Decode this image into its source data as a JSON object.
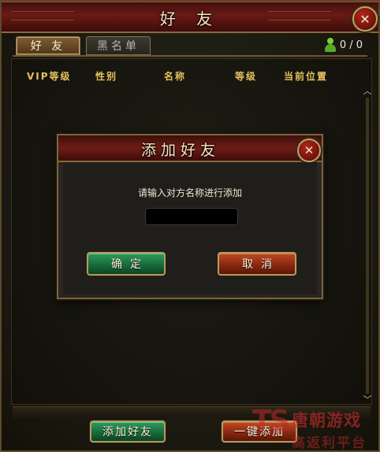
{
  "window": {
    "title": "好 友",
    "close_glyph": "✕"
  },
  "tabs": [
    {
      "label": "好 友",
      "active": true
    },
    {
      "label": "黑名单",
      "active": false
    }
  ],
  "online": {
    "icon": "person-icon",
    "text": "0 / 0"
  },
  "columns": [
    "VIP等级",
    "性别",
    "名称",
    "等级",
    "当前位置"
  ],
  "scrollbar": {
    "up_glyph": "︿",
    "down_glyph": "﹀"
  },
  "bottom": {
    "add_friend_label": "添加好友",
    "add_all_label": "一键添加"
  },
  "dialog": {
    "title": "添加好友",
    "close_glyph": "✕",
    "prompt": "请输入对方名称进行添加",
    "input_value": "",
    "confirm_label": "确定",
    "cancel_label": "取消"
  },
  "watermark": {
    "logo": "TS",
    "line1": "唐朝游戏",
    "line2": "高返利平台"
  },
  "colors": {
    "header_gold": "#e6c25e",
    "title_red": "#6a1a15",
    "button_green": "#176b3b",
    "button_red": "#8a2810"
  }
}
